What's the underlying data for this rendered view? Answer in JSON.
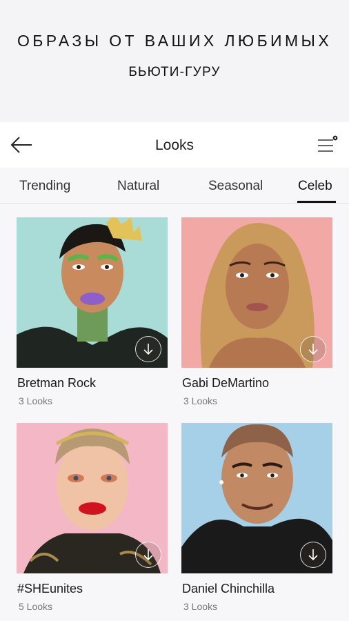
{
  "promo": {
    "title": "ОБРАЗЫ ОТ ВАШИХ ЛЮБИМЫХ",
    "subtitle": "БЬЮТИ-ГУРУ"
  },
  "nav": {
    "title": "Looks",
    "back_icon": "arrow-left-icon",
    "menu_icon": "filter-menu-icon"
  },
  "tabs": [
    {
      "label": "Trending",
      "active": false
    },
    {
      "label": "Natural",
      "active": false
    },
    {
      "label": "Seasonal",
      "active": false
    },
    {
      "label": "Celeb",
      "active": true
    }
  ],
  "cards": [
    {
      "name": "Bretman Rock",
      "count": "3 Looks",
      "bg": "#a9dcd6"
    },
    {
      "name": "Gabi DeMartino",
      "count": "3 Looks",
      "bg": "#f2a9a6"
    },
    {
      "name": "#SHEunites",
      "count": "5 Looks",
      "bg": "#f4b7c6"
    },
    {
      "name": "Daniel Chinchilla",
      "count": "3 Looks",
      "bg": "#a6cfe8"
    }
  ],
  "colors": {
    "accent": "#111111",
    "background": "#f7f7f9"
  }
}
